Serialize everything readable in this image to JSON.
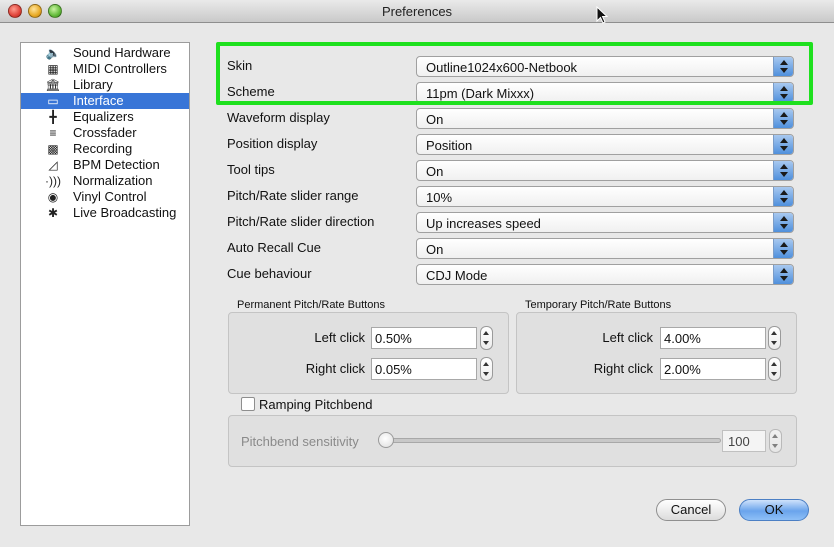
{
  "window": {
    "title": "Preferences"
  },
  "sidebar": {
    "items": [
      {
        "label": "Sound Hardware",
        "icon": "speaker-icon",
        "selected": false
      },
      {
        "label": "MIDI Controllers",
        "icon": "keyboard-icon",
        "selected": false
      },
      {
        "label": "Library",
        "icon": "library-icon",
        "selected": false
      },
      {
        "label": "Interface",
        "icon": "monitor-icon",
        "selected": true
      },
      {
        "label": "Equalizers",
        "icon": "equalizer-icon",
        "selected": false
      },
      {
        "label": "Crossfader",
        "icon": "crossfader-icon",
        "selected": false
      },
      {
        "label": "Recording",
        "icon": "tape-recorder-icon",
        "selected": false
      },
      {
        "label": "BPM Detection",
        "icon": "metronome-icon",
        "selected": false
      },
      {
        "label": "Normalization",
        "icon": "sound-waves-icon",
        "selected": false
      },
      {
        "label": "Vinyl Control",
        "icon": "vinyl-record-icon",
        "selected": false
      },
      {
        "label": "Live Broadcasting",
        "icon": "antenna-icon",
        "selected": false
      }
    ],
    "selected_color": "#3875d7"
  },
  "settings": [
    {
      "label": "Skin",
      "value": "Outline1024x600-Netbook"
    },
    {
      "label": "Scheme",
      "value": "11pm (Dark Mixxx)"
    },
    {
      "label": "Waveform display",
      "value": "On"
    },
    {
      "label": "Position display",
      "value": "Position"
    },
    {
      "label": "Tool tips",
      "value": "On"
    },
    {
      "label": "Pitch/Rate slider range",
      "value": "10%"
    },
    {
      "label": "Pitch/Rate slider direction",
      "value": "Up increases speed"
    },
    {
      "label": "Auto Recall Cue",
      "value": "On"
    },
    {
      "label": "Cue behaviour",
      "value": "CDJ Mode"
    }
  ],
  "highlight_color": "#1ee01e",
  "permanent": {
    "title": "Permanent Pitch/Rate Buttons",
    "left_label": "Left click",
    "left_value": "0.50%",
    "right_label": "Right click",
    "right_value": "0.05%"
  },
  "temporary": {
    "title": "Temporary Pitch/Rate Buttons",
    "left_label": "Left click",
    "left_value": "4.00%",
    "right_label": "Right click",
    "right_value": "2.00%"
  },
  "ramping": {
    "label": "Ramping Pitchbend",
    "checked": false
  },
  "pitchbend": {
    "label": "Pitchbend sensitivity",
    "value": "100"
  },
  "buttons": {
    "cancel": "Cancel",
    "ok": "OK"
  }
}
